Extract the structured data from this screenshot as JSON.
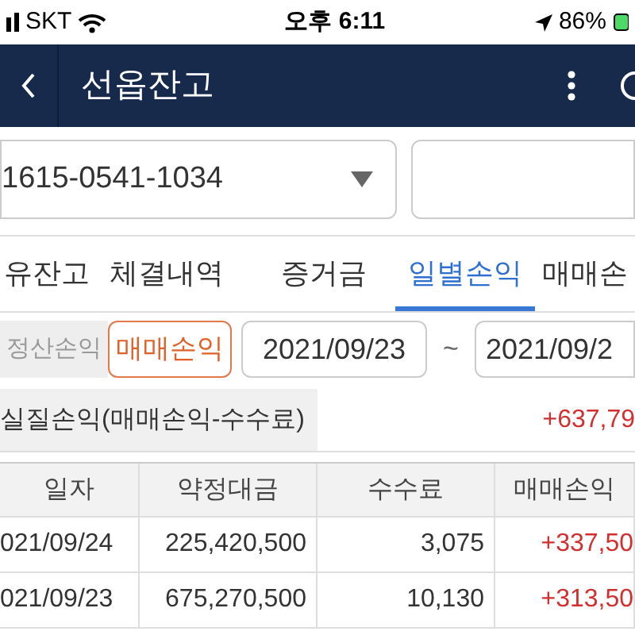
{
  "status_bar": {
    "carrier": "SKT",
    "time": "오후 6:11",
    "battery": "86%"
  },
  "header": {
    "title": "선옵잔고"
  },
  "account": {
    "value": "1615-0541-1034"
  },
  "tabs": [
    {
      "label": "유잔고",
      "selected": false
    },
    {
      "label": "체결내역",
      "selected": false
    },
    {
      "label": "증거금",
      "selected": false
    },
    {
      "label": "일별손익",
      "selected": true
    },
    {
      "label": "매매손",
      "selected": false
    }
  ],
  "filter": {
    "modes": [
      {
        "label": "정산손익",
        "selected": false
      },
      {
        "label": "매매손익",
        "selected": true
      }
    ],
    "date_from": "2021/09/23",
    "separator": "~",
    "date_to": "2021/09/2"
  },
  "summary": {
    "label": "실질손익(매매손익-수수료)",
    "value": "+637,79"
  },
  "table": {
    "columns": [
      "일자",
      "약정대금",
      "수수료",
      "매매손익"
    ],
    "rows": [
      [
        "021/09/24",
        "225,420,500",
        "3,075",
        "+337,50"
      ],
      [
        "021/09/23",
        "675,270,500",
        "10,130",
        "+313,50"
      ]
    ]
  }
}
